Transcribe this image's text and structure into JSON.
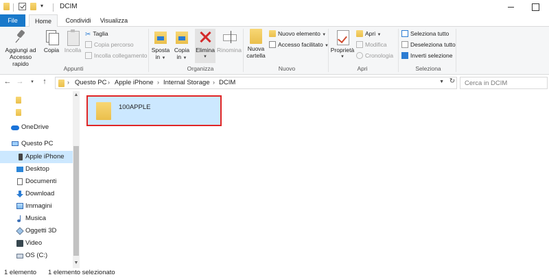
{
  "window": {
    "title": "DCIM",
    "icons": [
      "folder-icon",
      "checkmark-icon",
      "folder-icon",
      "dropdown-icon"
    ]
  },
  "ribbon_tabs": [
    "File",
    "Home",
    "Condividi",
    "Visualizza"
  ],
  "ribbon": {
    "appunti": {
      "label": "Appunti",
      "pin_line1": "Aggiungi ad",
      "pin_line2": "Accesso rapido",
      "copy": "Copia",
      "paste": "Incolla",
      "cut": "Taglia",
      "copy_path": "Copia percorso",
      "paste_link": "Incolla collegamento"
    },
    "organizza": {
      "label": "Organizza",
      "move_line1": "Sposta",
      "move_line2": "in",
      "copy_line1": "Copia",
      "copy_line2": "in",
      "delete": "Elimina",
      "rename": "Rinomina"
    },
    "nuovo": {
      "label": "Nuovo",
      "new_folder_line1": "Nuova",
      "new_folder_line2": "cartella",
      "new_item": "Nuovo elemento",
      "easy_access": "Accesso facilitato"
    },
    "apri": {
      "label": "Apri",
      "properties": "Proprietà",
      "open": "Apri",
      "edit": "Modifica",
      "history": "Cronologia"
    },
    "seleziona": {
      "label": "Seleziona",
      "select_all": "Seleziona tutto",
      "select_none": "Deseleziona tutto",
      "invert": "Inverti selezione"
    }
  },
  "address": {
    "crumbs": [
      "Questo PC",
      "Apple iPhone",
      "Internal Storage",
      "DCIM"
    ],
    "search_placeholder": "Cerca in DCIM"
  },
  "nav": {
    "items": [
      {
        "label": "",
        "icon": "folder-icon"
      },
      {
        "label": "",
        "icon": "folder-icon"
      },
      {
        "label": "OneDrive",
        "icon": "onedrive-icon"
      },
      {
        "label": "Questo PC",
        "icon": "computer-icon"
      },
      {
        "label": "Apple iPhone",
        "icon": "phone-icon",
        "selected": true
      },
      {
        "label": "Desktop",
        "icon": "desktop-icon"
      },
      {
        "label": "Documenti",
        "icon": "documents-icon"
      },
      {
        "label": "Download",
        "icon": "download-icon"
      },
      {
        "label": "Immagini",
        "icon": "pictures-icon"
      },
      {
        "label": "Musica",
        "icon": "music-icon"
      },
      {
        "label": "Oggetti 3D",
        "icon": "3d-objects-icon"
      },
      {
        "label": "Video",
        "icon": "video-icon"
      },
      {
        "label": "OS (C:)",
        "icon": "drive-icon"
      }
    ]
  },
  "files": [
    {
      "name": "100APPLE",
      "icon": "folder-icon",
      "selected": true
    }
  ],
  "status": {
    "count": "1 elemento",
    "selected": "1 elemento selezionato"
  },
  "colors": {
    "accent": "#1979ca",
    "selection": "#cce8ff",
    "highlight_border": "#e02525"
  }
}
